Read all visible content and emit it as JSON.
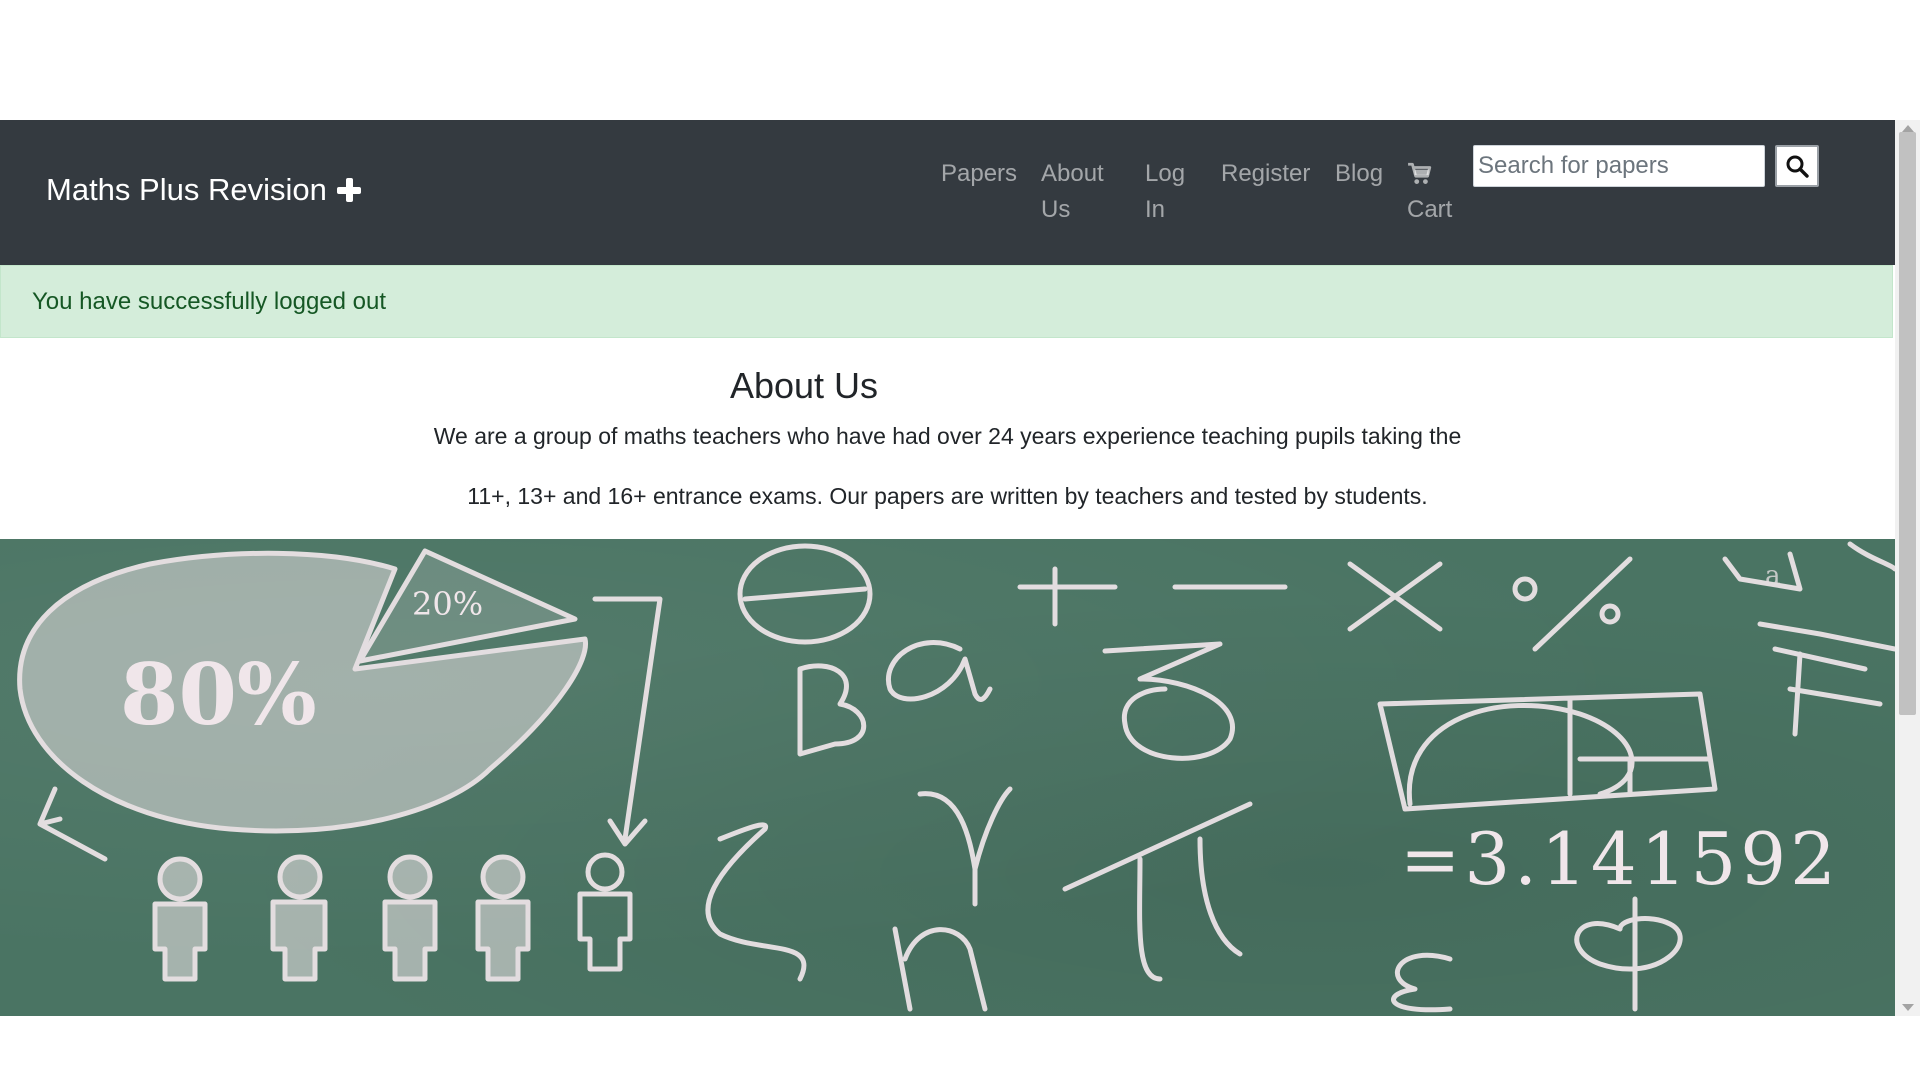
{
  "navbar": {
    "brand": "Maths Plus Revision",
    "links": {
      "papers": "Papers",
      "about_line1": "About",
      "about_line2": "Us",
      "login_line1": "Log",
      "login_line2": "In",
      "register": "Register",
      "blog": "Blog",
      "cart": "Cart"
    },
    "search": {
      "placeholder": "Search for papers"
    },
    "icons": {
      "brand": "plus-icon",
      "cart": "cart-icon",
      "search": "search-icon"
    }
  },
  "alert": {
    "message": "You have successfully logged out",
    "color": "#155724",
    "background": "#d4edda"
  },
  "about": {
    "title": "About Us",
    "line1": "We are a group of maths teachers who have had over 24 years experience teaching pupils taking the",
    "line2": "11+, 13+ and 16+ entrance exams. Our papers are written by teachers and tested by students."
  },
  "hero": {
    "pie_major": "80%",
    "pie_minor": "20%",
    "pi_value": "=3.141592",
    "greek": [
      "β",
      "a",
      "δ",
      "γ",
      "ζ",
      "η",
      "π",
      "φ",
      "ε",
      "θ"
    ],
    "operators": [
      "+",
      "−",
      "×",
      "%"
    ]
  },
  "colors": {
    "navbar": "#343a40",
    "chalkboard": "#4a7463",
    "chalk": "#f0e6ea"
  }
}
